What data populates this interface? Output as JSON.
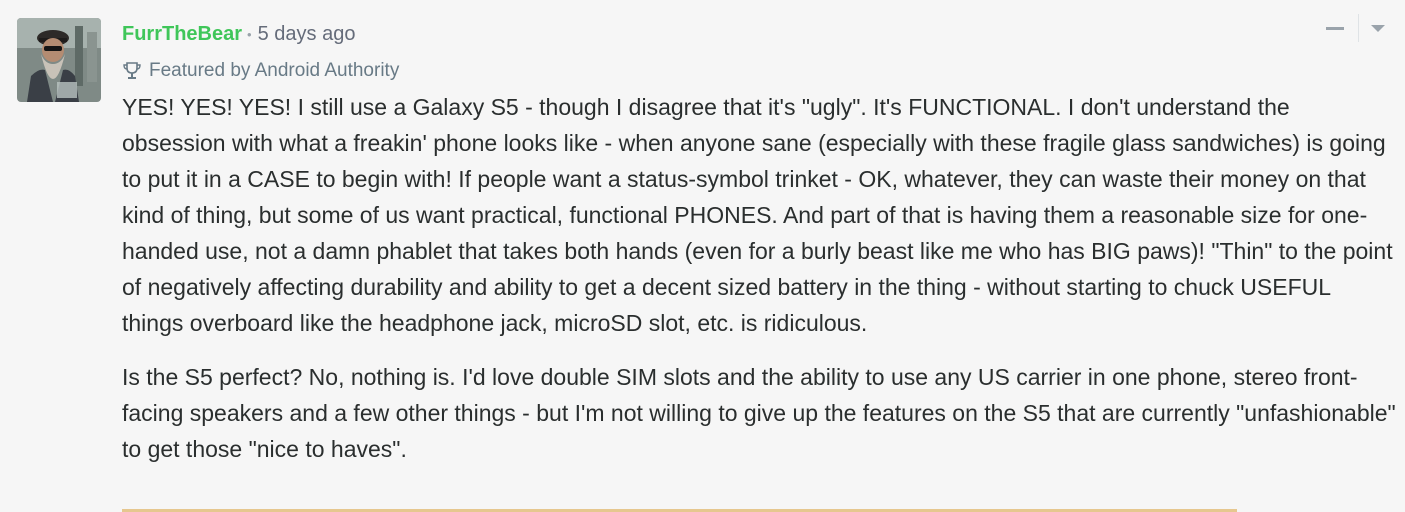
{
  "comment": {
    "author": "FurrTheBear",
    "separator": "•",
    "timestamp": "5 days ago",
    "featured_label": "Featured by Android Authority",
    "paragraphs": [
      "YES! YES! YES! I still use a Galaxy S5 - though I disagree that it's \"ugly\". It's FUNCTIONAL. I don't understand the obsession with what a freakin' phone looks like - when anyone sane (especially with these fragile glass sandwiches) is going to put it in a CASE to begin with! If people want a status-symbol trinket - OK, whatever, they can waste their money on that kind of thing, but some of us want practical, functional PHONES. And part of that is having them a reasonable size for one-handed use, not a damn phablet that takes both hands (even for a burly beast like me who has BIG paws)! \"Thin\" to the point of negatively affecting durability and ability to get a decent sized battery in the thing - without starting to chuck USEFUL things overboard like the headphone jack, microSD slot, etc. is ridiculous.",
      "Is the S5 perfect? No, nothing is. I'd love double SIM slots and the ability to use any US carrier in one phone, stereo front-facing speakers and a few other things - but I'm not willing to give up the features on the S5 that are currently \"unfashionable\" to get those \"nice to haves\"."
    ]
  },
  "icons": {
    "featured": "trophy-icon",
    "collapse": "minus-icon",
    "menu": "chevron-down-icon"
  },
  "colors": {
    "author": "#3fc659",
    "meta": "#656c7a",
    "body_text": "#2a2e2e",
    "background": "#f6f6f6"
  }
}
